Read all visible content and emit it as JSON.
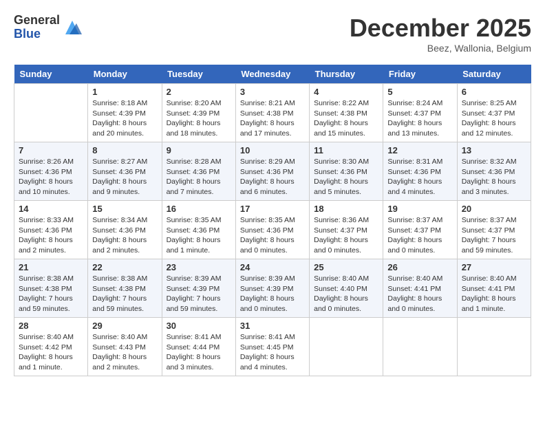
{
  "logo": {
    "general": "General",
    "blue": "Blue"
  },
  "title": "December 2025",
  "subtitle": "Beez, Wallonia, Belgium",
  "days_of_week": [
    "Sunday",
    "Monday",
    "Tuesday",
    "Wednesday",
    "Thursday",
    "Friday",
    "Saturday"
  ],
  "weeks": [
    [
      {
        "day": "",
        "sunrise": "",
        "sunset": "",
        "daylight": ""
      },
      {
        "day": "1",
        "sunrise": "Sunrise: 8:18 AM",
        "sunset": "Sunset: 4:39 PM",
        "daylight": "Daylight: 8 hours and 20 minutes."
      },
      {
        "day": "2",
        "sunrise": "Sunrise: 8:20 AM",
        "sunset": "Sunset: 4:39 PM",
        "daylight": "Daylight: 8 hours and 18 minutes."
      },
      {
        "day": "3",
        "sunrise": "Sunrise: 8:21 AM",
        "sunset": "Sunset: 4:38 PM",
        "daylight": "Daylight: 8 hours and 17 minutes."
      },
      {
        "day": "4",
        "sunrise": "Sunrise: 8:22 AM",
        "sunset": "Sunset: 4:38 PM",
        "daylight": "Daylight: 8 hours and 15 minutes."
      },
      {
        "day": "5",
        "sunrise": "Sunrise: 8:24 AM",
        "sunset": "Sunset: 4:37 PM",
        "daylight": "Daylight: 8 hours and 13 minutes."
      },
      {
        "day": "6",
        "sunrise": "Sunrise: 8:25 AM",
        "sunset": "Sunset: 4:37 PM",
        "daylight": "Daylight: 8 hours and 12 minutes."
      }
    ],
    [
      {
        "day": "7",
        "sunrise": "Sunrise: 8:26 AM",
        "sunset": "Sunset: 4:36 PM",
        "daylight": "Daylight: 8 hours and 10 minutes."
      },
      {
        "day": "8",
        "sunrise": "Sunrise: 8:27 AM",
        "sunset": "Sunset: 4:36 PM",
        "daylight": "Daylight: 8 hours and 9 minutes."
      },
      {
        "day": "9",
        "sunrise": "Sunrise: 8:28 AM",
        "sunset": "Sunset: 4:36 PM",
        "daylight": "Daylight: 8 hours and 7 minutes."
      },
      {
        "day": "10",
        "sunrise": "Sunrise: 8:29 AM",
        "sunset": "Sunset: 4:36 PM",
        "daylight": "Daylight: 8 hours and 6 minutes."
      },
      {
        "day": "11",
        "sunrise": "Sunrise: 8:30 AM",
        "sunset": "Sunset: 4:36 PM",
        "daylight": "Daylight: 8 hours and 5 minutes."
      },
      {
        "day": "12",
        "sunrise": "Sunrise: 8:31 AM",
        "sunset": "Sunset: 4:36 PM",
        "daylight": "Daylight: 8 hours and 4 minutes."
      },
      {
        "day": "13",
        "sunrise": "Sunrise: 8:32 AM",
        "sunset": "Sunset: 4:36 PM",
        "daylight": "Daylight: 8 hours and 3 minutes."
      }
    ],
    [
      {
        "day": "14",
        "sunrise": "Sunrise: 8:33 AM",
        "sunset": "Sunset: 4:36 PM",
        "daylight": "Daylight: 8 hours and 2 minutes."
      },
      {
        "day": "15",
        "sunrise": "Sunrise: 8:34 AM",
        "sunset": "Sunset: 4:36 PM",
        "daylight": "Daylight: 8 hours and 2 minutes."
      },
      {
        "day": "16",
        "sunrise": "Sunrise: 8:35 AM",
        "sunset": "Sunset: 4:36 PM",
        "daylight": "Daylight: 8 hours and 1 minute."
      },
      {
        "day": "17",
        "sunrise": "Sunrise: 8:35 AM",
        "sunset": "Sunset: 4:36 PM",
        "daylight": "Daylight: 8 hours and 0 minutes."
      },
      {
        "day": "18",
        "sunrise": "Sunrise: 8:36 AM",
        "sunset": "Sunset: 4:37 PM",
        "daylight": "Daylight: 8 hours and 0 minutes."
      },
      {
        "day": "19",
        "sunrise": "Sunrise: 8:37 AM",
        "sunset": "Sunset: 4:37 PM",
        "daylight": "Daylight: 8 hours and 0 minutes."
      },
      {
        "day": "20",
        "sunrise": "Sunrise: 8:37 AM",
        "sunset": "Sunset: 4:37 PM",
        "daylight": "Daylight: 7 hours and 59 minutes."
      }
    ],
    [
      {
        "day": "21",
        "sunrise": "Sunrise: 8:38 AM",
        "sunset": "Sunset: 4:38 PM",
        "daylight": "Daylight: 7 hours and 59 minutes."
      },
      {
        "day": "22",
        "sunrise": "Sunrise: 8:38 AM",
        "sunset": "Sunset: 4:38 PM",
        "daylight": "Daylight: 7 hours and 59 minutes."
      },
      {
        "day": "23",
        "sunrise": "Sunrise: 8:39 AM",
        "sunset": "Sunset: 4:39 PM",
        "daylight": "Daylight: 7 hours and 59 minutes."
      },
      {
        "day": "24",
        "sunrise": "Sunrise: 8:39 AM",
        "sunset": "Sunset: 4:39 PM",
        "daylight": "Daylight: 8 hours and 0 minutes."
      },
      {
        "day": "25",
        "sunrise": "Sunrise: 8:40 AM",
        "sunset": "Sunset: 4:40 PM",
        "daylight": "Daylight: 8 hours and 0 minutes."
      },
      {
        "day": "26",
        "sunrise": "Sunrise: 8:40 AM",
        "sunset": "Sunset: 4:41 PM",
        "daylight": "Daylight: 8 hours and 0 minutes."
      },
      {
        "day": "27",
        "sunrise": "Sunrise: 8:40 AM",
        "sunset": "Sunset: 4:41 PM",
        "daylight": "Daylight: 8 hours and 1 minute."
      }
    ],
    [
      {
        "day": "28",
        "sunrise": "Sunrise: 8:40 AM",
        "sunset": "Sunset: 4:42 PM",
        "daylight": "Daylight: 8 hours and 1 minute."
      },
      {
        "day": "29",
        "sunrise": "Sunrise: 8:40 AM",
        "sunset": "Sunset: 4:43 PM",
        "daylight": "Daylight: 8 hours and 2 minutes."
      },
      {
        "day": "30",
        "sunrise": "Sunrise: 8:41 AM",
        "sunset": "Sunset: 4:44 PM",
        "daylight": "Daylight: 8 hours and 3 minutes."
      },
      {
        "day": "31",
        "sunrise": "Sunrise: 8:41 AM",
        "sunset": "Sunset: 4:45 PM",
        "daylight": "Daylight: 8 hours and 4 minutes."
      },
      {
        "day": "",
        "sunrise": "",
        "sunset": "",
        "daylight": ""
      },
      {
        "day": "",
        "sunrise": "",
        "sunset": "",
        "daylight": ""
      },
      {
        "day": "",
        "sunrise": "",
        "sunset": "",
        "daylight": ""
      }
    ]
  ]
}
